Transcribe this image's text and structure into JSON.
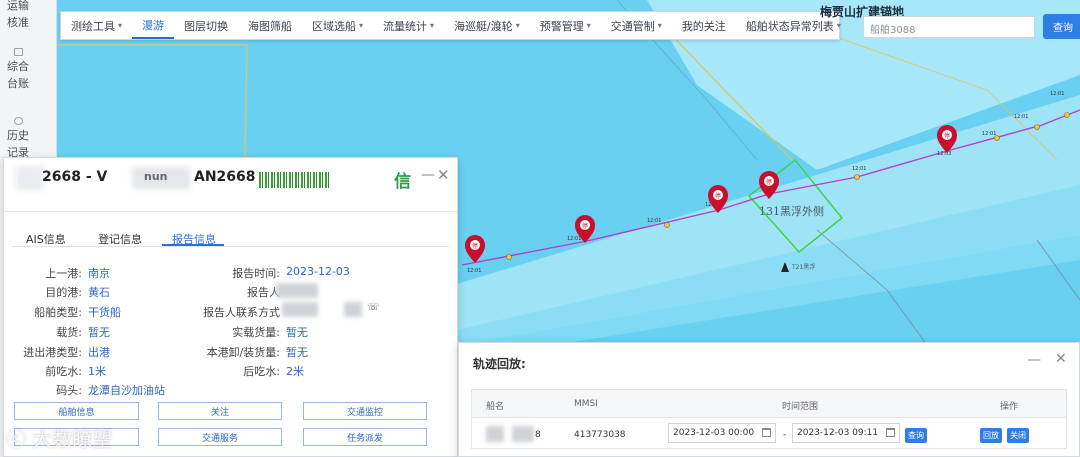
{
  "leftnav": {
    "items": [
      {
        "label": "运输核准"
      },
      {
        "label": "综合台账"
      },
      {
        "label": "历史记录"
      }
    ]
  },
  "toolbar": {
    "items": [
      {
        "label": "测绘工具",
        "has_menu": true
      },
      {
        "label": "漫游",
        "has_menu": false,
        "active": true
      },
      {
        "label": "图层切换",
        "has_menu": false
      },
      {
        "label": "海图筛船",
        "has_menu": false
      },
      {
        "label": "区域选船",
        "has_menu": true
      },
      {
        "label": "流量统计",
        "has_menu": true
      },
      {
        "label": "海巡艇/渡轮",
        "has_menu": true
      },
      {
        "label": "预警管理",
        "has_menu": true
      },
      {
        "label": "交通管制",
        "has_menu": true
      },
      {
        "label": "我的关注",
        "has_menu": false
      },
      {
        "label": "船舶状态异常列表",
        "has_menu": true
      }
    ]
  },
  "map": {
    "title": "梅贾山扩建锚地",
    "area_label": "131黑浮外侧",
    "buoy_label": "T21黑浮",
    "search_placeholder": "船舶3088",
    "search_button": "查询",
    "track_times": [
      "12:01",
      "12:01",
      "12:01",
      "12:01",
      "12:01",
      "12:01",
      "12:01",
      "12:01",
      "12:03"
    ],
    "marker_glyph": "停"
  },
  "ship_panel": {
    "title_fragments": [
      "2668 - V",
      "nun"
    ],
    "callsign": "AN2668",
    "badge": "信",
    "minimize": "—",
    "close": "✕",
    "tabs": [
      {
        "label": "AIS信息",
        "active": false
      },
      {
        "label": "登记信息",
        "active": false
      },
      {
        "label": "报告信息",
        "active": true
      }
    ],
    "fields_left": [
      {
        "label": "上一港:",
        "value": "南京"
      },
      {
        "label": "目的港:",
        "value": "黄石"
      },
      {
        "label": "船舶类型:",
        "value": "干货船"
      },
      {
        "label": "载货:",
        "value": "暂无"
      },
      {
        "label": "进出港类型:",
        "value": "出港"
      },
      {
        "label": "前吃水:",
        "value": "1米"
      },
      {
        "label": "码头:",
        "value": "龙潭自沙加油站"
      }
    ],
    "fields_right": [
      {
        "label": "报告时间:",
        "value": "2023-12-03"
      },
      {
        "label": "报告人",
        "value": ""
      },
      {
        "label": "报告人联系方式",
        "value": ""
      },
      {
        "label": "实载货量:",
        "value": "暂无"
      },
      {
        "label": "本港卸/装货量:",
        "value": "暂无"
      },
      {
        "label": "后吃水:",
        "value": "2米"
      }
    ],
    "buttons": [
      {
        "label": "船舶信息"
      },
      {
        "label": "关注"
      },
      {
        "label": "交通监控"
      },
      {
        "label": ""
      },
      {
        "label": "交通服务"
      },
      {
        "label": "任务派发"
      }
    ]
  },
  "replay": {
    "title": "轨迹回放:",
    "minimize": "—",
    "close": "✕",
    "columns": [
      "船名",
      "MMSI",
      "时间范围",
      "操作"
    ],
    "row": {
      "name_suffix": "8",
      "mmsi": "413773038",
      "start": "2023-12-03 00:00",
      "separator": "-",
      "end": "2023-12-03 09:11",
      "query_button": "查询",
      "replay_button": "回放",
      "close_button": "关闭"
    }
  },
  "watermark": {
    "text": "大数瞭望"
  },
  "colors": {
    "sea": "#6ad0f2",
    "channel": "#9fe3f7",
    "track": "#b342c9",
    "marker": "#c8102e",
    "accent": "#2f7ee6",
    "zone": "#3fd14a"
  }
}
